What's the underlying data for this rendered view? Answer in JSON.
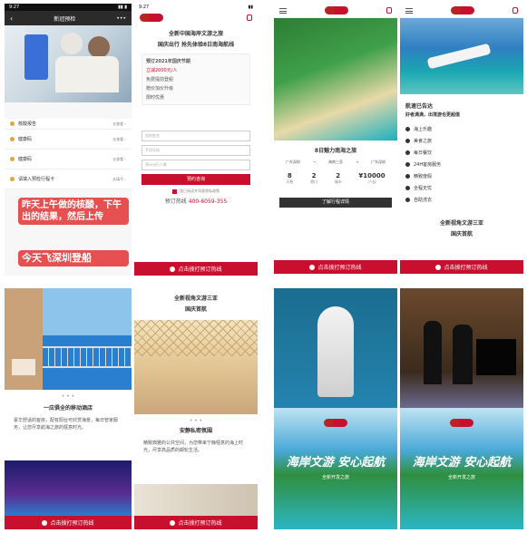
{
  "p1": {
    "title": "新冠预检",
    "menu": [
      {
        "label": "核酸报告",
        "action": "去查看 ›"
      },
      {
        "label": "健康码",
        "action": "去查看 ›"
      },
      {
        "label": "健康码",
        "action": "去查看 ›"
      },
      {
        "label": "请填入预检行程卡",
        "action": "去填写 ›"
      }
    ],
    "overlay1": "昨天上午做的核酸，下午出的结果，然后上传",
    "overlay2": "今天飞深圳登船"
  },
  "p2": {
    "headline1": "全新中国海岸文游之旅",
    "headline2": "国庆出行 抢先体验8日南海航线",
    "bullets": [
      "预订2021年国庆节期",
      "立减2000元/人",
      "免费提前登船",
      "赠价加价升级",
      "限时优惠"
    ],
    "form": [
      "您的姓名",
      "手机号码",
      "预计出行人数"
    ],
    "submit": "预约咨询",
    "agree": "我已阅读并同意隐私政策",
    "hotline_label": "预订热线",
    "hotline": "400-6059-355"
  },
  "p3": {
    "title": "8日魅力南海之旅",
    "from": "广东深圳",
    "via": "海南三亚",
    "to": "广东深圳",
    "stats": [
      {
        "value": "8",
        "label": "天数"
      },
      {
        "value": "2",
        "label": "港口"
      },
      {
        "value": "2",
        "label": "城市"
      },
      {
        "value": "¥10000",
        "label": "/人起"
      }
    ],
    "more": "了解行程详情"
  },
  "p4": {
    "h1": "航速已告达",
    "h2": "好者满满，出境游也更超值",
    "features": [
      "海上乐趣",
      "美食之旅",
      "每日餐饮",
      "24H客房服务",
      "精致度假",
      "全程无忧",
      "自助洗衣"
    ]
  },
  "p5": {
    "heading": "一应俱全的移动酒店",
    "body": "豪华舒适的客房，配有阳台可欣赏海景，每日管家服务，让您尽享航海之旅的惬意时光。"
  },
  "p6": {
    "h1": "全新视角文游三亚",
    "h2": "国庆首航",
    "sub": "安静私密氛围",
    "body": "精致典雅的公共空间，为您带来宁静惬意的海上时光，尽享高品质的邮轮生活。"
  },
  "p7": {
    "h1": "全新视角文游三亚",
    "h2": "国庆首航"
  },
  "p8": {
    "banner": "海岸文游 安心起航",
    "sub": "全新开发之旅"
  },
  "bottom_cta": "点击拨打预订热线",
  "colors": {
    "brand": "#c8102e"
  }
}
